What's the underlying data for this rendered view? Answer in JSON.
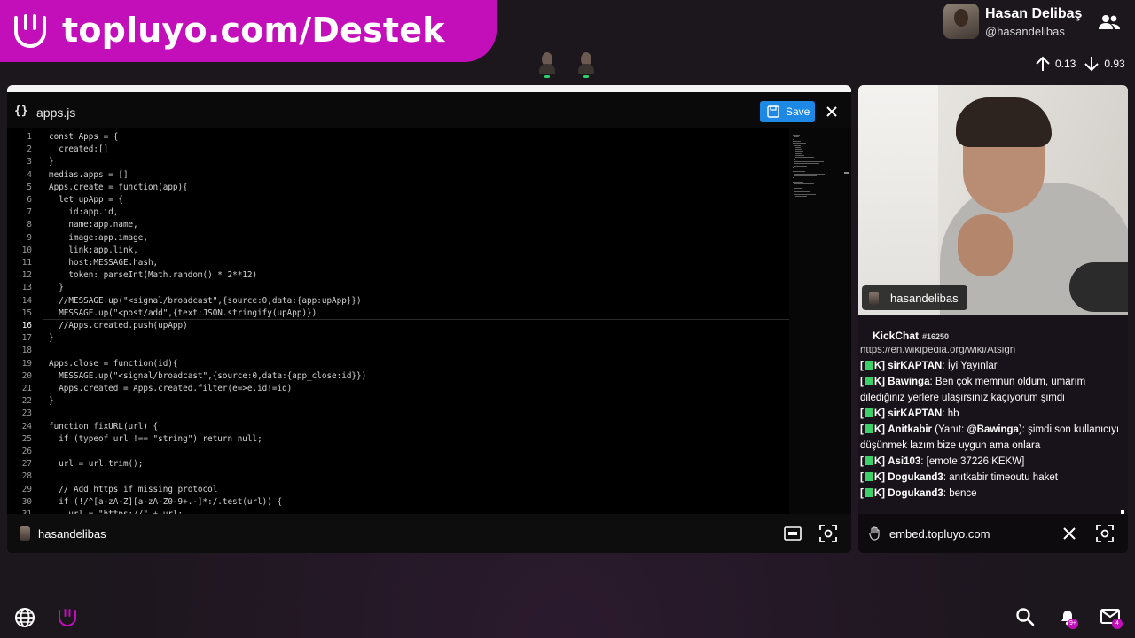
{
  "banner": {
    "url_text": "topluyo.com/Destek"
  },
  "user": {
    "name": "Hasan Delibaş",
    "handle": "@hasandelibas"
  },
  "stats": {
    "up": "0.13",
    "down": "0.93"
  },
  "editor": {
    "file_icon": "{}",
    "file_name": "apps.js",
    "save_label": "Save",
    "current_line": 16,
    "lines": [
      "const Apps = {",
      "  created:[]",
      "}",
      "medias.apps = []",
      "Apps.create = function(app){",
      "  let upApp = {",
      "    id:app.id,",
      "    name:app.name,",
      "    image:app.image,",
      "    link:app.link,",
      "    host:MESSAGE.hash,",
      "    token: parseInt(Math.random() * 2**12)",
      "  }",
      "  //MESSAGE.up(\"<signal/broadcast\",{source:0,data:{app:upApp}})",
      "  MESSAGE.up(\"<post/add\",{text:JSON.stringify(upApp)})",
      "  //Apps.created.push(upApp)",
      "}",
      "",
      "Apps.close = function(id){",
      "  MESSAGE.up(\"<signal/broadcast\",{source:0,data:{app_close:id}})",
      "  Apps.created = Apps.created.filter(e=>e.id!=id)",
      "}",
      "",
      "function fixURL(url) {",
      "  if (typeof url !== \"string\") return null;",
      "",
      "  url = url.trim();",
      "",
      "  // Add https if missing protocol",
      "  if (!/^[a-zA-Z][a-zA-Z0-9+.-]*:/.test(url)) {",
      "    url = \"https://\" + url;"
    ],
    "footer_name": "hasandelibas"
  },
  "cam": {
    "tag": "hasandelibas"
  },
  "chat": {
    "title": "KickChat",
    "count": "#16250",
    "cut_line": "https://en.wikipedia.org/wiki/Atsign",
    "messages": [
      {
        "prefix": "[",
        "tag": "K]",
        "user": "sirKAPTAN",
        "text": ": İyi Yayınlar"
      },
      {
        "prefix": "[",
        "tag": "K]",
        "user": "Bawinga",
        "text": ": Ben çok memnun oldum, umarım dilediğiniz yerlere ulaşırsınız kaçıyorum şimdi"
      },
      {
        "prefix": "[",
        "tag": "K]",
        "user": "sirKAPTAN",
        "text": ": hb"
      },
      {
        "prefix": "[",
        "tag": "K]",
        "user": "Anitkabir",
        "text": " (Yanıt: ",
        "reply": "@Bawinga",
        "text2": "): şimdi son kullanıcıyı düşünmek lazım bize uygun ama onlara"
      },
      {
        "prefix": "[",
        "tag": "K]",
        "user": "Asi103",
        "text": ": [emote:37226:KEKW]"
      },
      {
        "prefix": "[",
        "tag": "K]",
        "user": "Dogukand3",
        "text": ": anıtkabir timeoutu haket"
      },
      {
        "prefix": "[",
        "tag": "K]",
        "user": "Dogukand3",
        "text": ": bence"
      }
    ]
  },
  "embed": {
    "url": "embed.topluyo.com"
  },
  "notifications": {
    "bell_badge": "9+",
    "mail_badge": "4"
  },
  "colors": {
    "brand": "#c20fb9",
    "save": "#1e88e5",
    "badge_green": "#3ccf6a"
  }
}
